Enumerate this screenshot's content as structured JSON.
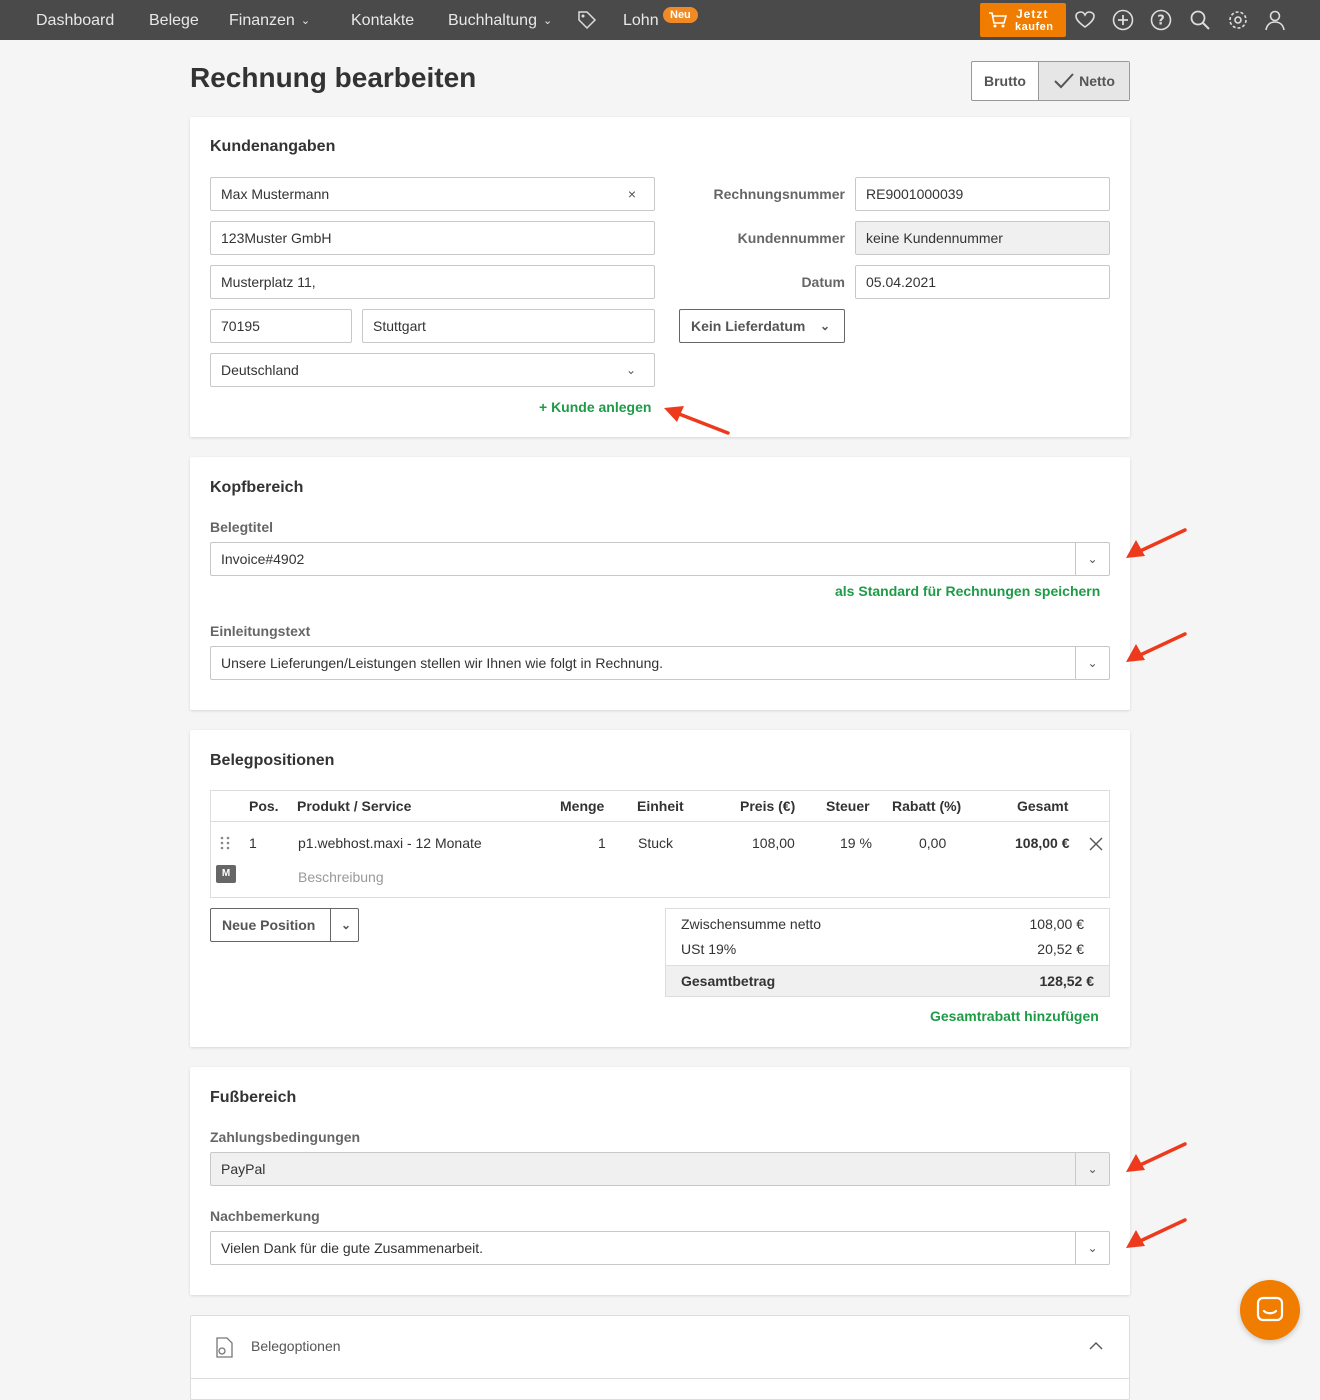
{
  "nav": {
    "items": [
      "Dashboard",
      "Belege",
      "Finanzen",
      "Kontakte",
      "Buchhaltung",
      "Lohn"
    ],
    "badge_new": "Neu",
    "buy_line1": "Jetzt",
    "buy_line2": "kaufen",
    "icons": [
      "tag-icon",
      "heart-icon",
      "plus-circle-icon",
      "help-icon",
      "search-icon",
      "gear-icon",
      "user-icon"
    ]
  },
  "header": {
    "title": "Rechnung bearbeiten",
    "toggle_brutto": "Brutto",
    "toggle_netto": "Netto"
  },
  "kunden": {
    "title": "Kundenangaben",
    "name": "Max Mustermann",
    "company": "123Muster GmbH",
    "street": "Musterplatz 11,",
    "zip": "70195",
    "city": "Stuttgart",
    "country": "Deutschland",
    "add_customer": "+ Kunde anlegen",
    "lbl_invoice_no": "Rechnungsnummer",
    "invoice_no": "RE9001000039",
    "lbl_customer_no": "Kundennummer",
    "customer_no": "keine Kundennummer",
    "lbl_date": "Datum",
    "date": "05.04.2021",
    "delivery": "Kein Lieferdatum"
  },
  "kopf": {
    "title": "Kopfbereich",
    "lbl_belegtitel": "Belegtitel",
    "belegtitel": "Invoice#4902",
    "save_default": "als Standard für Rechnungen speichern",
    "lbl_einleitung": "Einleitungstext",
    "einleitung": "Unsere Lieferungen/Leistungen stellen wir Ihnen wie folgt in Rechnung."
  },
  "positionen": {
    "title": "Belegpositionen",
    "columns": [
      "Pos.",
      "Produkt / Service",
      "Menge",
      "Einheit",
      "Preis (€)",
      "Steuer",
      "Rabatt (%)",
      "Gesamt"
    ],
    "row": {
      "pos": "1",
      "product": "p1.webhost.maxi - 12 Monate",
      "menge": "1",
      "einheit": "Stuck",
      "preis": "108,00",
      "steuer": "19 %",
      "rabatt": "0,00",
      "gesamt": "108,00 €",
      "description_placeholder": "Beschreibung",
      "badge": "M"
    },
    "new_position": "Neue Position",
    "subtotal_label": "Zwischensumme netto",
    "subtotal": "108,00 €",
    "tax_label": "USt 19%",
    "tax": "20,52 €",
    "total_label": "Gesamtbetrag",
    "total": "128,52 €",
    "add_discount": "Gesamtrabatt hinzufügen"
  },
  "fuss": {
    "title": "Fußbereich",
    "lbl_payment": "Zahlungsbedingungen",
    "payment": "PayPal",
    "lbl_note": "Nachbemerkung",
    "note": "Vielen Dank für die gute Zusammenarbeit."
  },
  "options": {
    "title": "Belegoptionen"
  },
  "colors": {
    "nav_bg": "#4a4a4a",
    "accent_orange": "#f07d00",
    "link_green": "#1e9b47",
    "annotation_red": "#ee3a1c"
  }
}
